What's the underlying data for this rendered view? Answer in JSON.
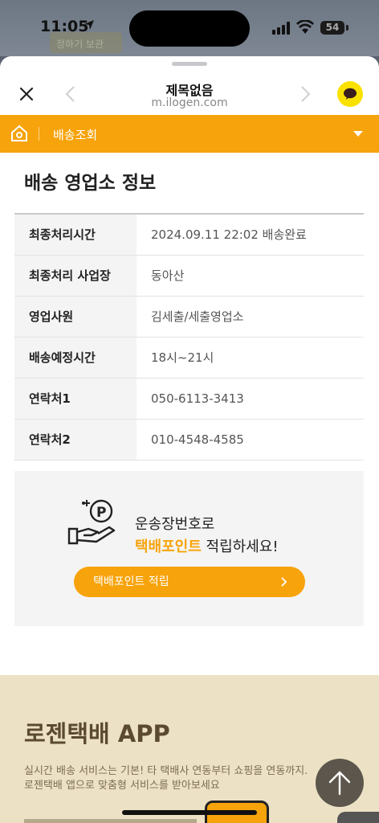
{
  "status_bar": {
    "time": "11:05",
    "battery": "54"
  },
  "background_hint": "정하기 보관",
  "browser": {
    "title": "제목없음",
    "url": "m.ilogen.com",
    "icons": [
      "close-icon",
      "back-arrow-icon",
      "forward-arrow-icon",
      "kakao-talk-icon"
    ]
  },
  "nav": {
    "label": "배송조회"
  },
  "section_title": "배송 영업소 정보",
  "info_rows": [
    {
      "key": "최종처리시간",
      "value": "2024.09.11 22:02 배송완료"
    },
    {
      "key": "최종처리 사업장",
      "value": "동아산"
    },
    {
      "key": "영업사원",
      "value": "김세출/세출영업소"
    },
    {
      "key": "배송예정시간",
      "value": "18시~21시"
    },
    {
      "key": "연락처1",
      "value": "050-6113-3413"
    },
    {
      "key": "연락처2",
      "value": "010-4548-4585"
    }
  ],
  "promo": {
    "line1": "운송장번호로",
    "line2_highlight": "택배포인트",
    "line2_rest": " 적립하세요!",
    "button_label": "택배포인트 적립"
  },
  "app_section": {
    "title": "로젠택배 APP",
    "desc1": "실시간 배송 서비스는 기본! 타 택배사 연동부터 쇼핑을 연동까지.",
    "desc2": "로젠택배 앱으로 맞춤형 서비스를 받아보세요"
  },
  "colors": {
    "accent": "#f7a30b",
    "kakao": "#fae100",
    "app_bg": "#ede1c5"
  }
}
